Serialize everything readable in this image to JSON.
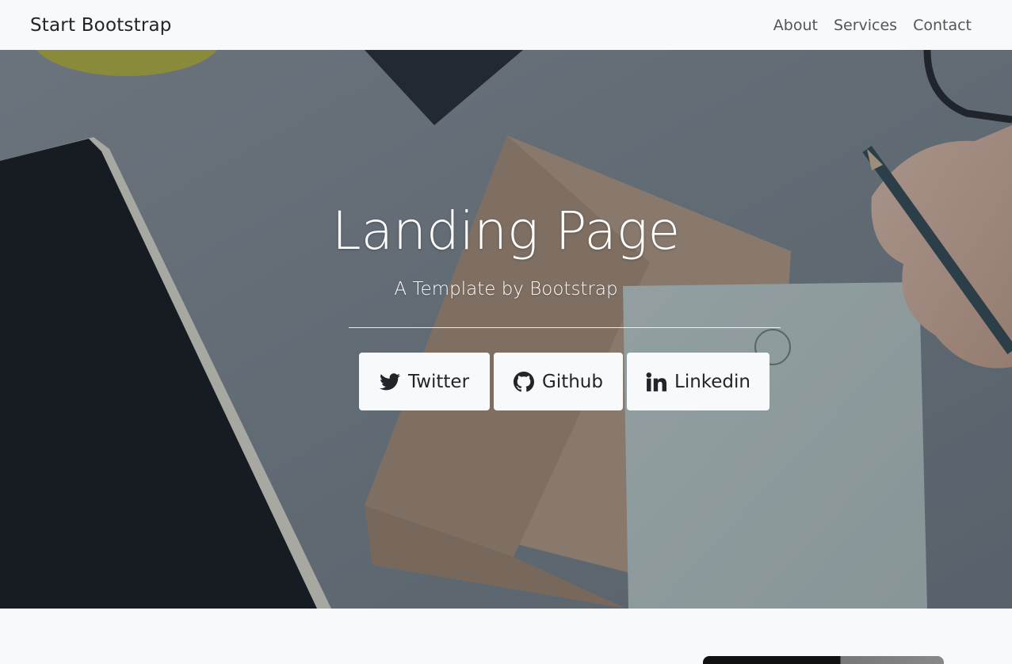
{
  "navbar": {
    "brand": "Start Bootstrap",
    "links": [
      "About",
      "Services",
      "Contact"
    ]
  },
  "hero": {
    "title": "Landing Page",
    "subtitle": "A Template by Bootstrap",
    "social_buttons": [
      {
        "label": "Twitter",
        "icon": "twitter-icon"
      },
      {
        "label": "Github",
        "icon": "github-icon"
      },
      {
        "label": "Linkedin",
        "icon": "linkedin-icon"
      }
    ]
  },
  "colors": {
    "navbar_bg": "#f8f9fa",
    "button_bg": "#f8f9fa",
    "text_dark": "#212529",
    "hero_text": "#ffffff"
  }
}
